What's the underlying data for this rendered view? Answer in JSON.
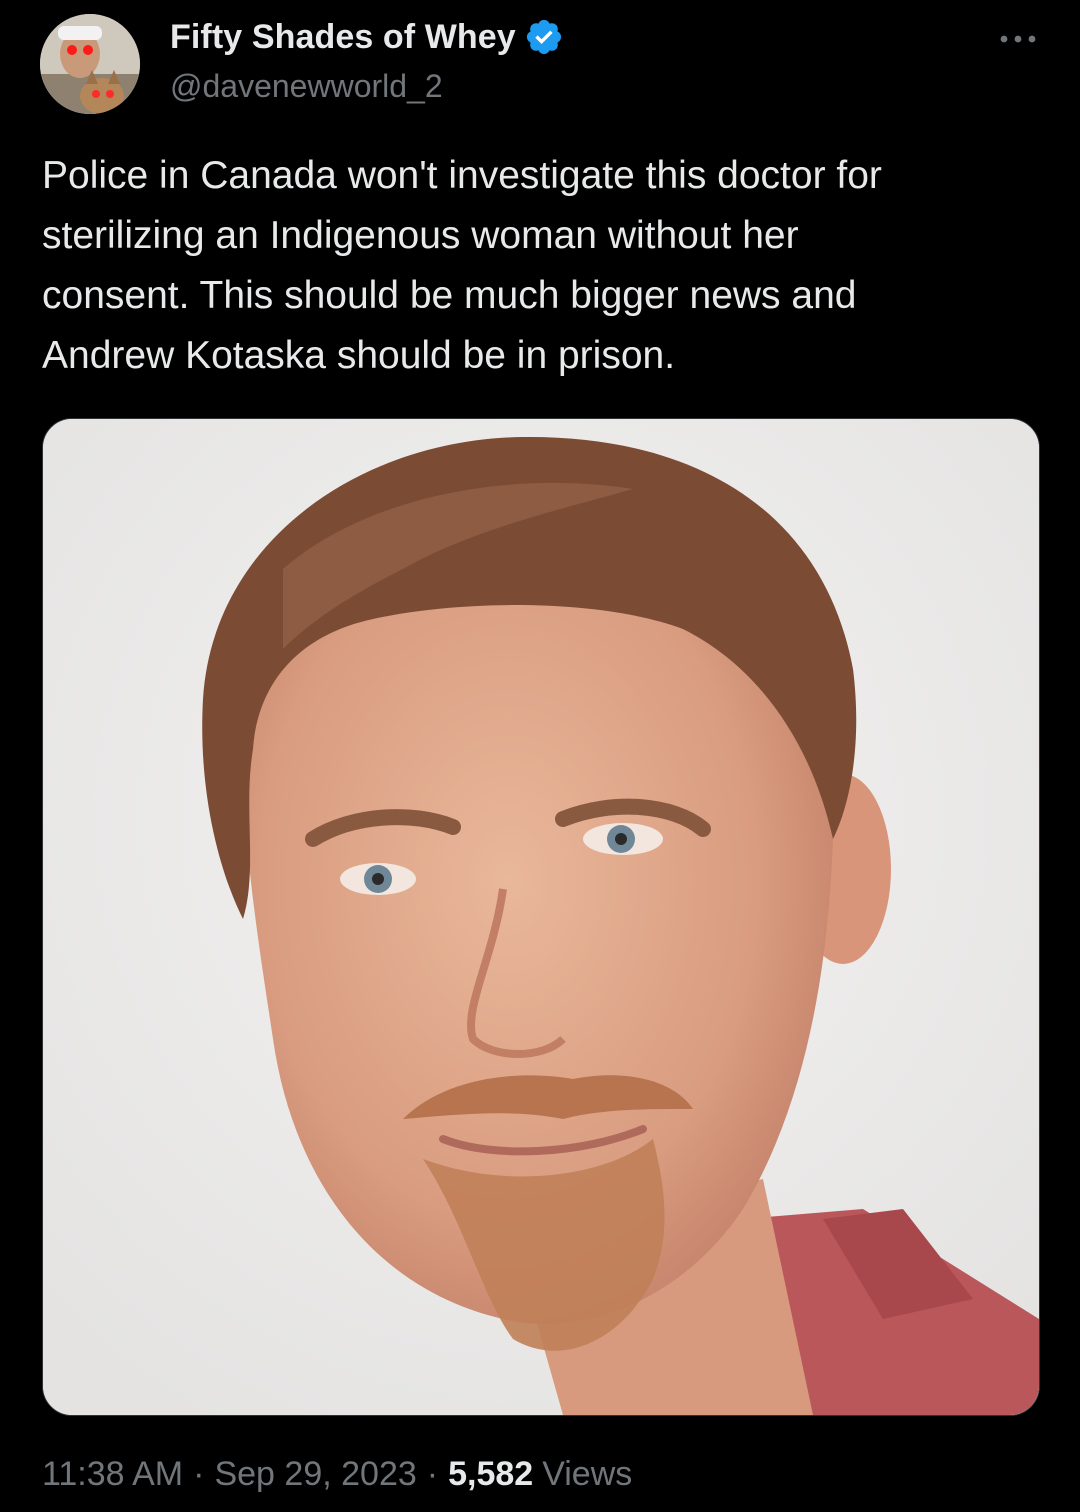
{
  "author": {
    "display_name": "Fifty Shades of Whey",
    "handle": "@davenewworld_2",
    "verified": true,
    "verified_badge_color": "#1d9bf0",
    "avatar_icon": "avatar-photo"
  },
  "tweet": {
    "text": "Police in Canada won't investigate this doctor for\nsterilizing an Indigenous woman without her\nconsent. This should be much bigger news and\nAndrew Kotaska should be in prison.",
    "media_icon": "portrait-photo"
  },
  "meta": {
    "time": "11:38 AM",
    "separator": "·",
    "date": "Sep 29, 2023",
    "views_count": "5,582",
    "views_label": "Views"
  },
  "actions": {
    "more_icon": "more-horizontal-icon"
  },
  "colors": {
    "background": "#000000",
    "primary_text": "#e7e9ea",
    "secondary_text": "#71767b",
    "border": "#2f3336"
  }
}
